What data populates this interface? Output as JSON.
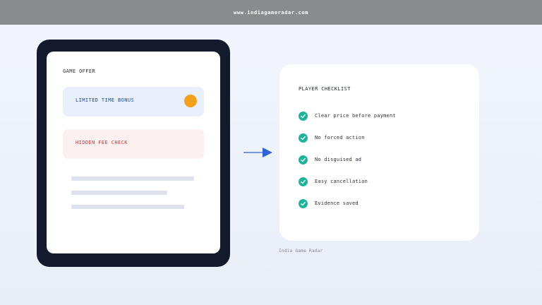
{
  "header": {
    "url": "www.indiagameradar.com"
  },
  "offer": {
    "title": "GAME OFFER",
    "bonus_label": "LIMITED TIME BONUS",
    "fee_label": "HIDDEN FEE CHECK"
  },
  "checklist": {
    "title": "PLAYER CHECKLIST",
    "items": [
      {
        "label": "Clear price before payment"
      },
      {
        "label": "No forced action"
      },
      {
        "label": "No disguised ad"
      },
      {
        "label": "Easy cancellation"
      },
      {
        "label": "Evidence saved"
      }
    ]
  },
  "footer": {
    "credit": "India Game Radar"
  },
  "colors": {
    "accent_orange": "#f3a01b",
    "check_green": "#1fb39b",
    "arrow_blue": "#2f63d8",
    "phone_frame": "#121a2b"
  }
}
